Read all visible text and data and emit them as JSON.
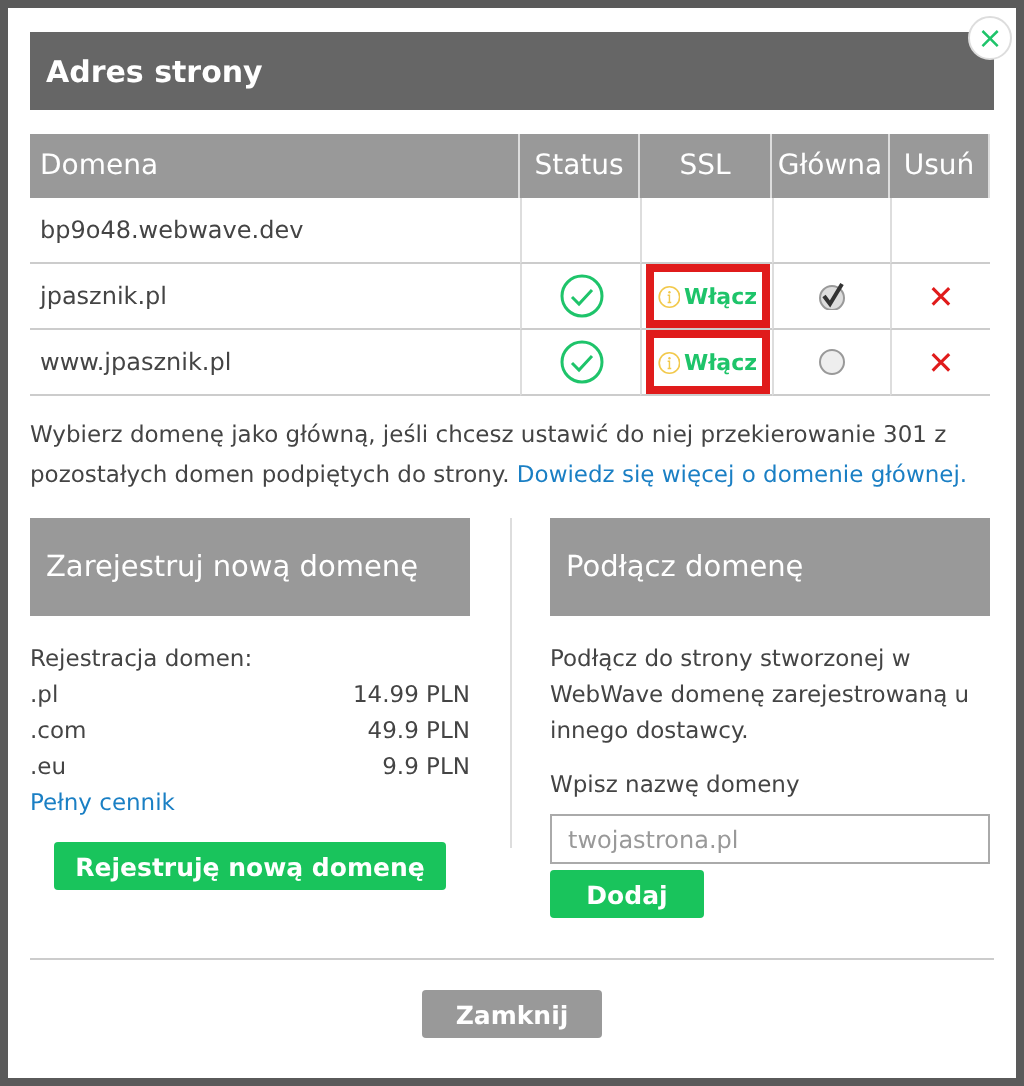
{
  "dialog": {
    "title": "Adres strony",
    "close_icon": "×"
  },
  "table": {
    "columns": [
      "Domena",
      "Status",
      "SSL",
      "Główna",
      "Usuń"
    ],
    "rows": [
      {
        "domain": "bp9o48.webwave.dev",
        "kind": "system"
      },
      {
        "domain": "jpasznik.pl",
        "kind": "custom",
        "status_ok": true,
        "ssl_label": "Włącz",
        "ssl_highlighted": true,
        "main": {
          "selected": true
        },
        "delete": "✕"
      },
      {
        "domain": "www.jpasznik.pl",
        "kind": "custom",
        "status_ok": true,
        "ssl_label": "Włącz",
        "ssl_highlighted": true,
        "main": {
          "selected": false
        },
        "delete": "✕"
      }
    ]
  },
  "note": {
    "text": "Wybierz domenę jako główną, jeśli chcesz ustawić do niej przekierowanie 301 z pozostałych domen podpiętych do strony.",
    "link": "Dowiedz się więcej o domenie głównej."
  },
  "register": {
    "title": "Zarejestruj nową domenę",
    "subtitle": "Rejestracja domen:",
    "prices": [
      {
        "tld": ".pl",
        "price": "14.99 PLN"
      },
      {
        "tld": ".com",
        "price": "49.9 PLN"
      },
      {
        "tld": ".eu",
        "price": "9.9 PLN"
      }
    ],
    "link": "Pełny cennik",
    "button": "Rejestruję nową domenę"
  },
  "connect": {
    "title": "Podłącz domenę",
    "text": "Podłącz do strony stworzonej w WebWave domenę zarejestrowaną u innego dostawcy.",
    "label": "Wpisz nazwę domeny",
    "placeholder": "twojastrona.pl",
    "button": "Dodaj"
  },
  "footer": {
    "button": "Zamknij"
  }
}
